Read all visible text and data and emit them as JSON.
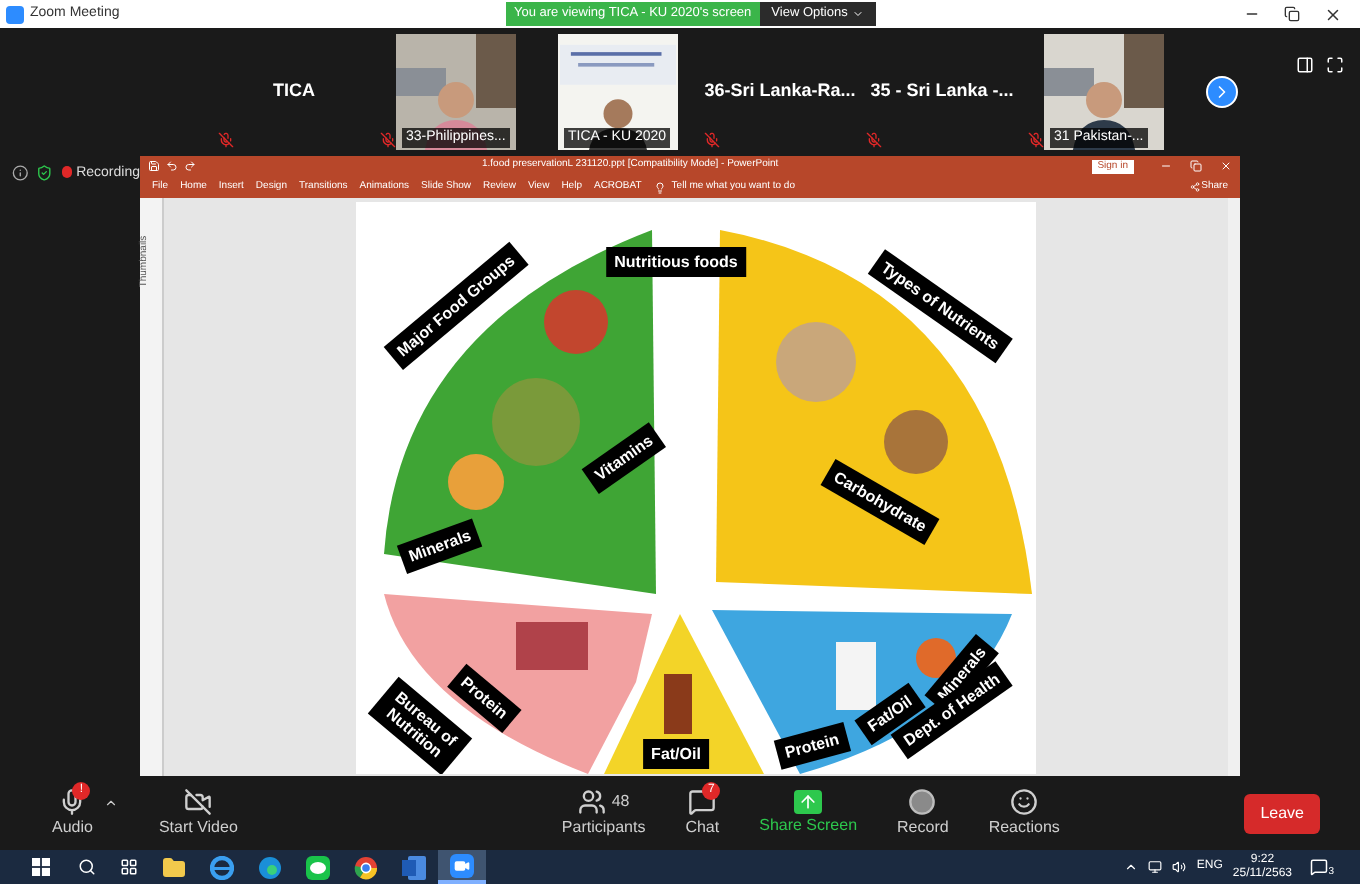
{
  "window": {
    "title": "Zoom Meeting",
    "banner": "You are viewing TICA - KU 2020's screen",
    "view_options": "View Options"
  },
  "gallery": {
    "tiles": [
      {
        "name": "TICA",
        "kind": "name",
        "muted": true
      },
      {
        "name": "33-Philippines...",
        "kind": "video",
        "muted": true
      },
      {
        "name": "TICA - KU 2020",
        "kind": "video",
        "muted": false
      },
      {
        "name": "36-Sri  Lanka-Ra...",
        "kind": "name",
        "muted": true
      },
      {
        "name": "35 - Sri Lanka -...",
        "kind": "name",
        "muted": true
      },
      {
        "name": "31 Pakistan-...",
        "kind": "video",
        "muted": true
      }
    ]
  },
  "indicators": {
    "recording": "Recording"
  },
  "powerpoint": {
    "title": "1.food preservationL 231120.ppt [Compatibility Mode] - PowerPoint",
    "sign_in": "Sign in",
    "tabs": [
      "File",
      "Home",
      "Insert",
      "Design",
      "Transitions",
      "Animations",
      "Slide Show",
      "Review",
      "View",
      "Help",
      "ACROBAT"
    ],
    "tell_me": "Tell me what you want to do",
    "share": "Share",
    "thumbnails": "Thumbnails",
    "slide": {
      "labels": [
        {
          "text": "Nutritious foods"
        },
        {
          "text": "Major  Food Groups"
        },
        {
          "text": "Types  of Nutrients"
        },
        {
          "text": "Vitamins"
        },
        {
          "text": "Minerals"
        },
        {
          "text": "Carbohydrate"
        },
        {
          "text": "Protein"
        },
        {
          "text": "Bureau of Nutrition"
        },
        {
          "text": "Fat/Oil"
        },
        {
          "text": "Protein"
        },
        {
          "text": "Fat/Oil"
        },
        {
          "text": "Minerals"
        },
        {
          "text": "Dept.  of Health"
        }
      ]
    }
  },
  "toolbar": {
    "buttons": [
      {
        "kind": "audio",
        "label": "Audio",
        "badge": "!"
      },
      {
        "kind": "video",
        "label": "Start Video"
      },
      {
        "kind": "participants",
        "label": "Participants",
        "count": "48"
      },
      {
        "kind": "chat",
        "label": "Chat",
        "badge": "7"
      },
      {
        "kind": "share",
        "label": "Share Screen"
      },
      {
        "kind": "record",
        "label": "Record"
      },
      {
        "kind": "reactions",
        "label": "Reactions"
      }
    ],
    "leave": "Leave"
  },
  "taskbar": {
    "apps": [
      {
        "kind": "explorer",
        "active": false
      },
      {
        "kind": "ie",
        "active": false
      },
      {
        "kind": "edge",
        "active": false
      },
      {
        "kind": "line",
        "active": false
      },
      {
        "kind": "chrome",
        "active": false
      },
      {
        "kind": "word",
        "active": false
      },
      {
        "kind": "zoom",
        "active": true
      }
    ],
    "language": "ENG",
    "time": "9:22",
    "date": "25/11/2563",
    "notifications": "3"
  }
}
